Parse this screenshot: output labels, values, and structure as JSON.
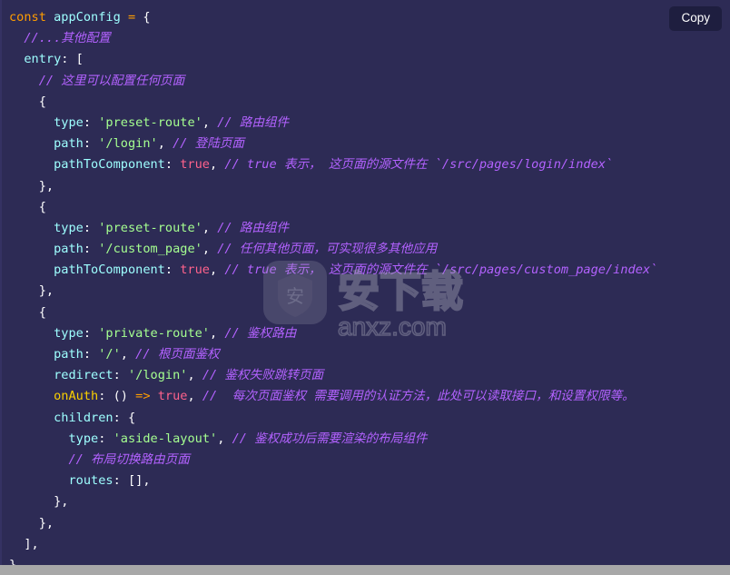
{
  "widget": {
    "name": "code-snippet-viewer",
    "language": "javascript",
    "background_color": "#2d2b55",
    "foreground_color": "#ffffff"
  },
  "toolbar": {
    "copy_label": "Copy"
  },
  "palette": {
    "keyword": "#ff9d00",
    "variable": "#9effff",
    "property": "#9effff",
    "function": "#fad000",
    "string": "#a5ff90",
    "boolean": "#ff628c",
    "comment": "#b362ff",
    "punctuation": "#ffffff",
    "operator": "#ff9d00"
  },
  "watermark": {
    "logo_text": "安",
    "brand_text": "安下载",
    "domain_text": "anxz.com"
  },
  "scrollbar": {
    "orientation": "horizontal",
    "track_color": "#f1f1f1",
    "thumb_color": "#a8a8a8"
  },
  "code": {
    "lines": [
      "const appConfig = {",
      "  //...其他配置",
      "  entry: [",
      "    // 这里可以配置任何页面",
      "    {",
      "      type: 'preset-route', // 路由组件",
      "      path: '/login', // 登陆页面",
      "      pathToComponent: true, // true 表示， 这页面的源文件在 `/src/pages/login/index`",
      "    },",
      "    {",
      "      type: 'preset-route', // 路由组件",
      "      path: '/custom_page', // 任何其他页面，可实现很多其他应用",
      "      pathToComponent: true, // true 表示， 这页面的源文件在 `/src/pages/custom_page/index`",
      "    },",
      "    {",
      "      type: 'private-route', // 鉴权路由",
      "      path: '/', // 根页面鉴权",
      "      redirect: '/login', // 鉴权失败跳转页面",
      "      onAuth: () => true, //  每次页面鉴权 需要调用的认证方法，此处可以读取接口，和设置权限等。",
      "      children: {",
      "        type: 'aside-layout', // 鉴权成功后需要渲染的布局组件",
      "        // 布局切换路由页面",
      "        routes: [],",
      "      },",
      "    },",
      "  ],",
      "}"
    ]
  }
}
